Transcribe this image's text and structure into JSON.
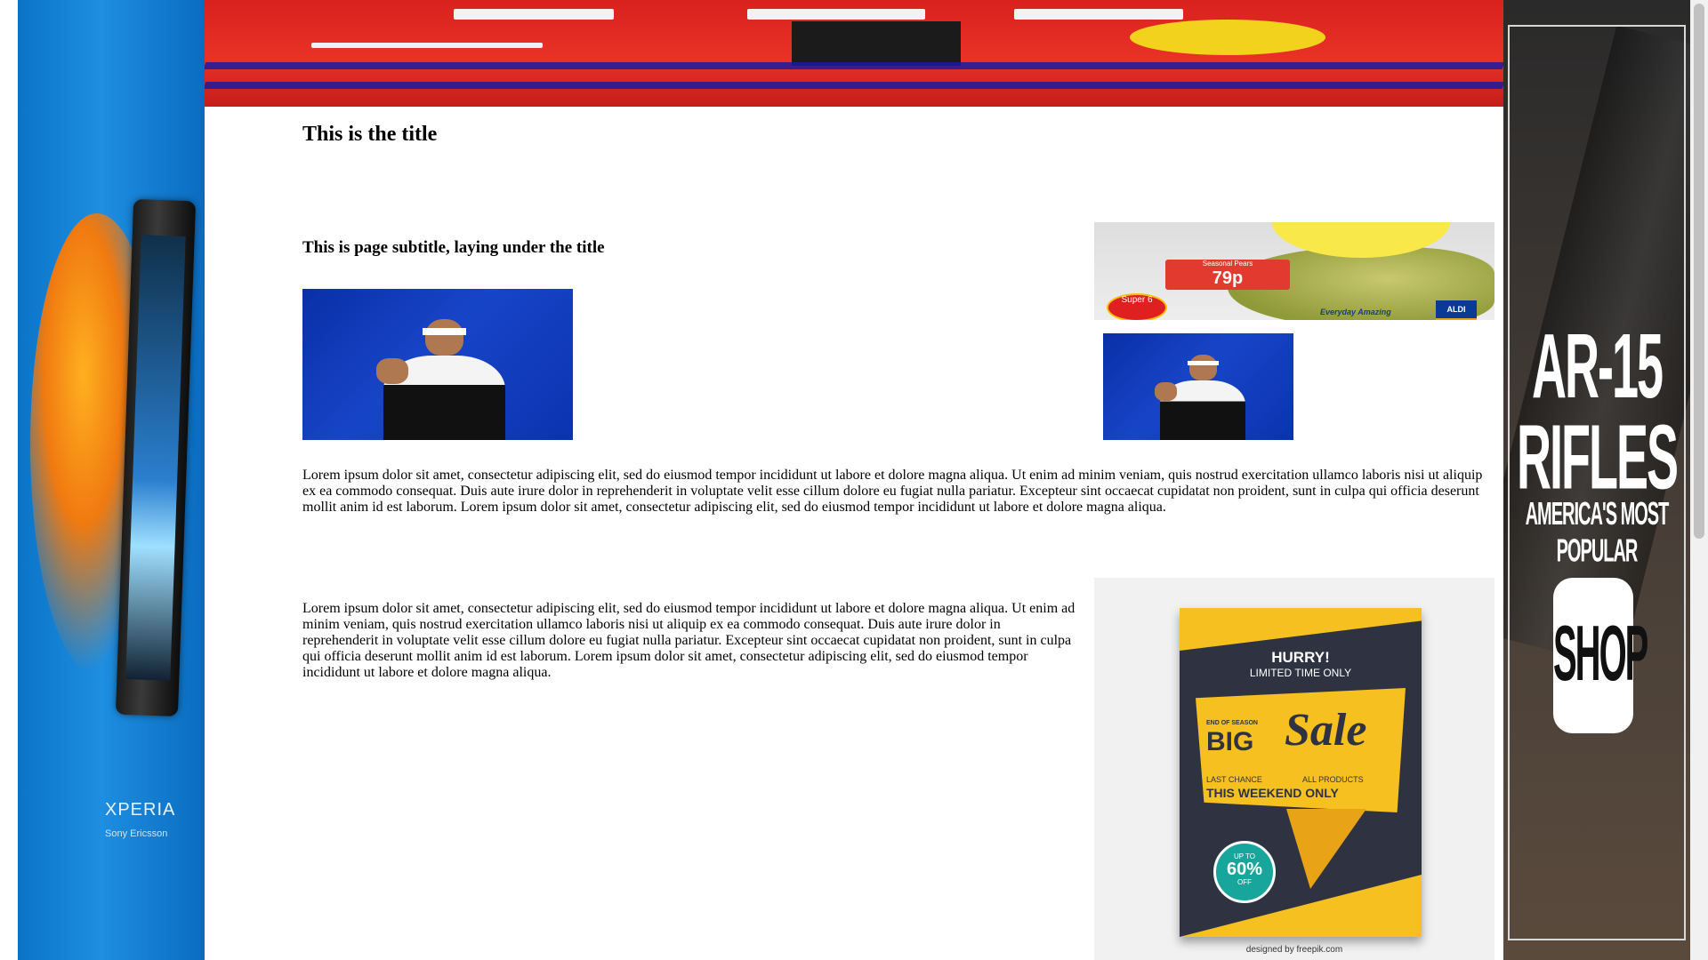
{
  "page": {
    "title": "This is the title",
    "subtitle": "This is page subtitle, laying under the title",
    "paragraph_1": "Lorem ipsum dolor sit amet, consectetur adipiscing elit, sed do eiusmod tempor incididunt ut labore et dolore magna aliqua. Ut enim ad minim veniam, quis nostrud exercitation ullamco laboris nisi ut aliquip ex ea commodo consequat. Duis aute irure dolor in reprehenderit in voluptate velit esse cillum dolore eu fugiat nulla pariatur. Excepteur sint occaecat cupidatat non proident, sunt in culpa qui officia deserunt mollit anim id est laborum. Lorem ipsum dolor sit amet, consectetur adipiscing elit, sed do eiusmod tempor incididunt ut labore et dolore magna aliqua.",
    "paragraph_2": "Lorem ipsum dolor sit amet, consectetur adipiscing elit, sed do eiusmod tempor incididunt ut labore et dolore magna aliqua. Ut enim ad minim veniam, quis nostrud exercitation ullamco laboris nisi ut aliquip ex ea commodo consequat. Duis aute irure dolor in reprehenderit in voluptate velit esse cillum dolore eu fugiat nulla pariatur. Excepteur sint occaecat cupidatat non proident, sunt in culpa qui officia deserunt mollit anim id est laborum. Lorem ipsum dolor sit amet, consectetur adipiscing elit, sed do eiusmod tempor incididunt ut labore et dolore magna aliqua."
  },
  "ads": {
    "left": {
      "brand": "XPERIA",
      "brand_sub": "Sony Ericsson"
    },
    "aldi": {
      "price_label": "Seasonal Pears",
      "price": "79p",
      "badge": "Super 6",
      "tagline": "Everyday Amazing",
      "logo": "ALDI"
    },
    "sale": {
      "hurry": "HURRY!",
      "limited": "LIMITED TIME ONLY",
      "end_of_season": "END OF SEASON",
      "big": "BIG",
      "sale": "Sale",
      "last_chance": "LAST CHANCE",
      "all_products": "ALL PRODUCTS",
      "weekend": "THIS WEEKEND ONLY",
      "up_to": "UP TO",
      "percent": "60%",
      "off": "OFF",
      "credit": "designed by freepik.com"
    },
    "right": {
      "headline": "AR-15 RIFLES",
      "tagline": "AMERICA'S MOST POPULAR",
      "shop": "SHOP"
    }
  },
  "colors": {
    "banner_red": "#d9211e",
    "left_ad_blue": "#0a74c8",
    "sale_yellow": "#f6c020",
    "sale_dark": "#2f3341"
  }
}
